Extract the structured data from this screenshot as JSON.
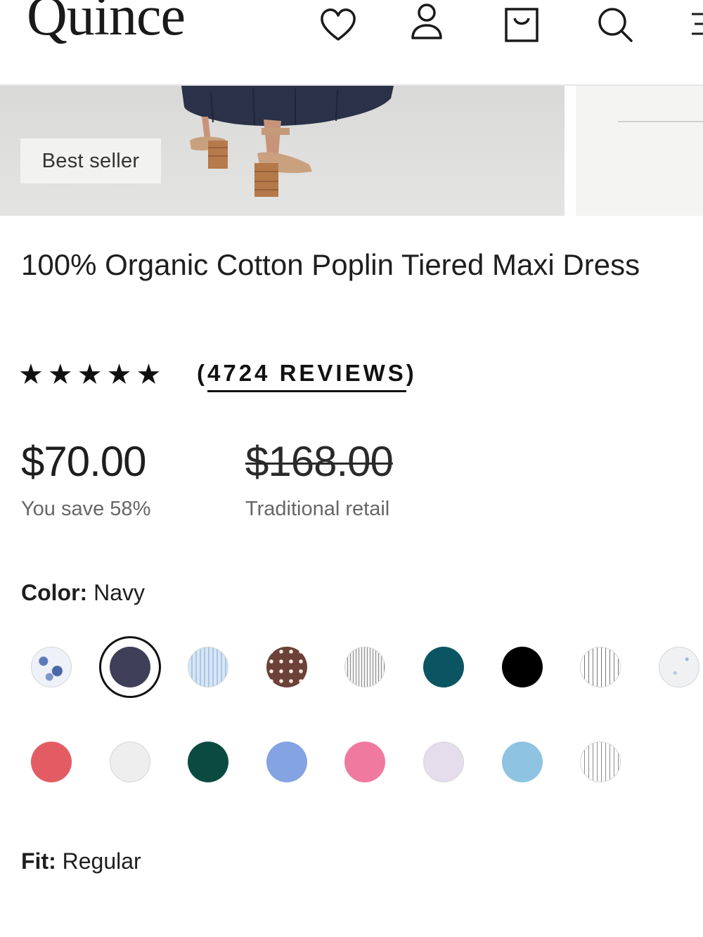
{
  "header": {
    "logo": "Quince",
    "icons": [
      "heart-icon",
      "user-icon",
      "shopping-bag-icon",
      "search-icon",
      "menu-icon"
    ]
  },
  "hero": {
    "badge": "Best seller"
  },
  "product": {
    "title": "100% Organic Cotton Poplin Tiered Maxi Dress",
    "rating_stars": "★★★★★",
    "rating": 5,
    "reviews_open": "(",
    "reviews_label": "4724 REVIEWS",
    "reviews_close": ")",
    "price": "$70.00",
    "price_note": "You save 58%",
    "retail_price": "$168.00",
    "retail_note": "Traditional retail"
  },
  "color": {
    "label": "Color:",
    "value": "Navy",
    "selected": "navy",
    "swatches": [
      {
        "id": "blue-floral",
        "color": "#c9d4ea"
      },
      {
        "id": "navy",
        "color": "#3f3f5a"
      },
      {
        "id": "light-blue-stripe",
        "color": "#dfeaf6"
      },
      {
        "id": "brown-dot",
        "color": "#6b4138"
      },
      {
        "id": "grey-stripe",
        "color": "#e6e6e6"
      },
      {
        "id": "teal",
        "color": "#0b5563"
      },
      {
        "id": "black",
        "color": "#000000"
      },
      {
        "id": "white-stripe",
        "color": "#f4f4f4"
      },
      {
        "id": "white-speckle",
        "color": "#f0f1f2"
      },
      {
        "id": "coral-red",
        "color": "#e45c63"
      },
      {
        "id": "white",
        "color": "#eeeeee"
      },
      {
        "id": "dark-green",
        "color": "#0b4a40"
      },
      {
        "id": "periwinkle",
        "color": "#84a3e2"
      },
      {
        "id": "pink",
        "color": "#f0799f"
      },
      {
        "id": "lavender",
        "color": "#e5dcec"
      },
      {
        "id": "sky-blue",
        "color": "#8ec3e1"
      },
      {
        "id": "ivory-stripe",
        "color": "#f6f6f6"
      }
    ]
  },
  "fit": {
    "label": "Fit:",
    "value": "Regular"
  }
}
